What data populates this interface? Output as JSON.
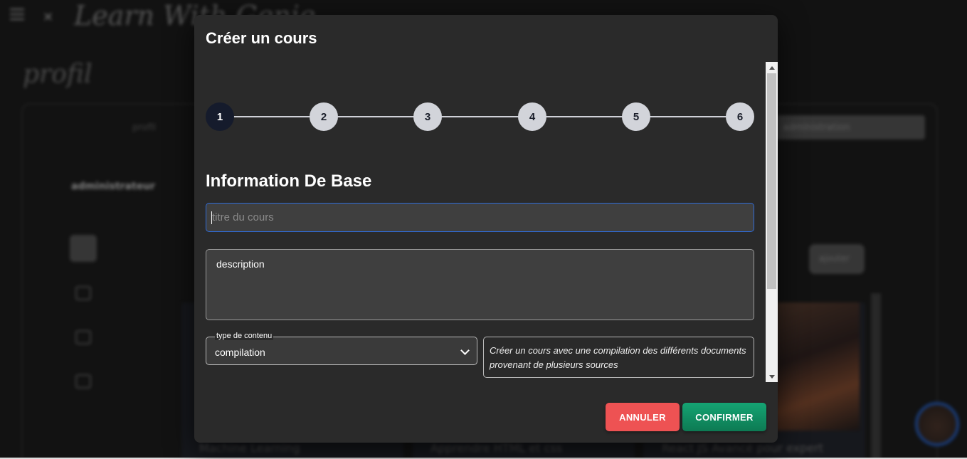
{
  "background": {
    "logo_text": "Learn With Genie",
    "page_title": "profil",
    "tab_left": "profil",
    "tab_right": "administration",
    "user_role": "administrateur",
    "action_button": "ajouter",
    "course_cards": [
      {
        "title": "Machine Learning"
      },
      {
        "title": "Apprendre HTML et css"
      },
      {
        "title": "React JS Avancé pour expert"
      }
    ]
  },
  "modal": {
    "title": "Créer un cours",
    "steps": [
      "1",
      "2",
      "3",
      "4",
      "5",
      "6"
    ],
    "active_step": 1,
    "section_title": "Information De Base",
    "title_field": {
      "placeholder": "titre du cours",
      "value": ""
    },
    "description_field": {
      "placeholder": "description"
    },
    "content_type": {
      "label": "type de contenu",
      "selected": "compilation",
      "description": "Créer un cours avec une compilation des différents documents provenant de plusieurs sources"
    },
    "buttons": {
      "cancel": "ANNULER",
      "confirm": "CONFIRMER"
    }
  },
  "colors": {
    "cancel": "#ee5253",
    "confirm": "#0d8a5c",
    "active_step": "#151b2c",
    "focus_border": "#2f6bd8"
  }
}
